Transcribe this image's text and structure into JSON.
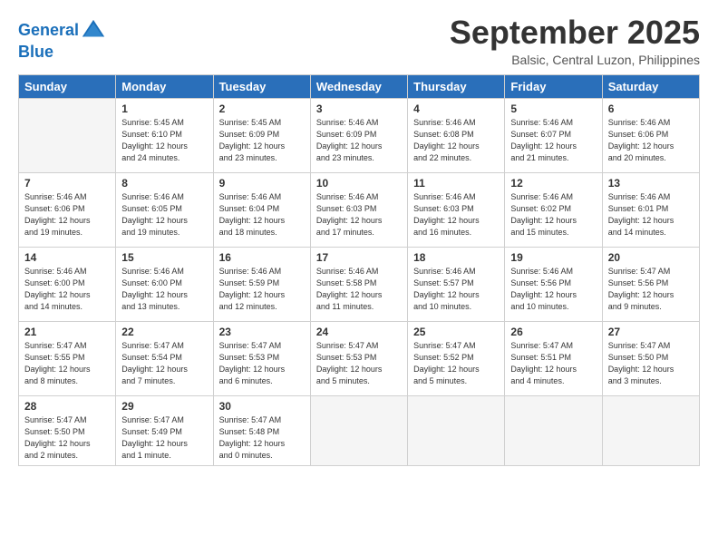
{
  "header": {
    "logo_line1": "General",
    "logo_line2": "Blue",
    "month_title": "September 2025",
    "location": "Balsic, Central Luzon, Philippines"
  },
  "days_of_week": [
    "Sunday",
    "Monday",
    "Tuesday",
    "Wednesday",
    "Thursday",
    "Friday",
    "Saturday"
  ],
  "weeks": [
    [
      {
        "day": "",
        "info": ""
      },
      {
        "day": "1",
        "info": "Sunrise: 5:45 AM\nSunset: 6:10 PM\nDaylight: 12 hours\nand 24 minutes."
      },
      {
        "day": "2",
        "info": "Sunrise: 5:45 AM\nSunset: 6:09 PM\nDaylight: 12 hours\nand 23 minutes."
      },
      {
        "day": "3",
        "info": "Sunrise: 5:46 AM\nSunset: 6:09 PM\nDaylight: 12 hours\nand 23 minutes."
      },
      {
        "day": "4",
        "info": "Sunrise: 5:46 AM\nSunset: 6:08 PM\nDaylight: 12 hours\nand 22 minutes."
      },
      {
        "day": "5",
        "info": "Sunrise: 5:46 AM\nSunset: 6:07 PM\nDaylight: 12 hours\nand 21 minutes."
      },
      {
        "day": "6",
        "info": "Sunrise: 5:46 AM\nSunset: 6:06 PM\nDaylight: 12 hours\nand 20 minutes."
      }
    ],
    [
      {
        "day": "7",
        "info": "Sunrise: 5:46 AM\nSunset: 6:06 PM\nDaylight: 12 hours\nand 19 minutes."
      },
      {
        "day": "8",
        "info": "Sunrise: 5:46 AM\nSunset: 6:05 PM\nDaylight: 12 hours\nand 19 minutes."
      },
      {
        "day": "9",
        "info": "Sunrise: 5:46 AM\nSunset: 6:04 PM\nDaylight: 12 hours\nand 18 minutes."
      },
      {
        "day": "10",
        "info": "Sunrise: 5:46 AM\nSunset: 6:03 PM\nDaylight: 12 hours\nand 17 minutes."
      },
      {
        "day": "11",
        "info": "Sunrise: 5:46 AM\nSunset: 6:03 PM\nDaylight: 12 hours\nand 16 minutes."
      },
      {
        "day": "12",
        "info": "Sunrise: 5:46 AM\nSunset: 6:02 PM\nDaylight: 12 hours\nand 15 minutes."
      },
      {
        "day": "13",
        "info": "Sunrise: 5:46 AM\nSunset: 6:01 PM\nDaylight: 12 hours\nand 14 minutes."
      }
    ],
    [
      {
        "day": "14",
        "info": "Sunrise: 5:46 AM\nSunset: 6:00 PM\nDaylight: 12 hours\nand 14 minutes."
      },
      {
        "day": "15",
        "info": "Sunrise: 5:46 AM\nSunset: 6:00 PM\nDaylight: 12 hours\nand 13 minutes."
      },
      {
        "day": "16",
        "info": "Sunrise: 5:46 AM\nSunset: 5:59 PM\nDaylight: 12 hours\nand 12 minutes."
      },
      {
        "day": "17",
        "info": "Sunrise: 5:46 AM\nSunset: 5:58 PM\nDaylight: 12 hours\nand 11 minutes."
      },
      {
        "day": "18",
        "info": "Sunrise: 5:46 AM\nSunset: 5:57 PM\nDaylight: 12 hours\nand 10 minutes."
      },
      {
        "day": "19",
        "info": "Sunrise: 5:46 AM\nSunset: 5:56 PM\nDaylight: 12 hours\nand 10 minutes."
      },
      {
        "day": "20",
        "info": "Sunrise: 5:47 AM\nSunset: 5:56 PM\nDaylight: 12 hours\nand 9 minutes."
      }
    ],
    [
      {
        "day": "21",
        "info": "Sunrise: 5:47 AM\nSunset: 5:55 PM\nDaylight: 12 hours\nand 8 minutes."
      },
      {
        "day": "22",
        "info": "Sunrise: 5:47 AM\nSunset: 5:54 PM\nDaylight: 12 hours\nand 7 minutes."
      },
      {
        "day": "23",
        "info": "Sunrise: 5:47 AM\nSunset: 5:53 PM\nDaylight: 12 hours\nand 6 minutes."
      },
      {
        "day": "24",
        "info": "Sunrise: 5:47 AM\nSunset: 5:53 PM\nDaylight: 12 hours\nand 5 minutes."
      },
      {
        "day": "25",
        "info": "Sunrise: 5:47 AM\nSunset: 5:52 PM\nDaylight: 12 hours\nand 5 minutes."
      },
      {
        "day": "26",
        "info": "Sunrise: 5:47 AM\nSunset: 5:51 PM\nDaylight: 12 hours\nand 4 minutes."
      },
      {
        "day": "27",
        "info": "Sunrise: 5:47 AM\nSunset: 5:50 PM\nDaylight: 12 hours\nand 3 minutes."
      }
    ],
    [
      {
        "day": "28",
        "info": "Sunrise: 5:47 AM\nSunset: 5:50 PM\nDaylight: 12 hours\nand 2 minutes."
      },
      {
        "day": "29",
        "info": "Sunrise: 5:47 AM\nSunset: 5:49 PM\nDaylight: 12 hours\nand 1 minute."
      },
      {
        "day": "30",
        "info": "Sunrise: 5:47 AM\nSunset: 5:48 PM\nDaylight: 12 hours\nand 0 minutes."
      },
      {
        "day": "",
        "info": ""
      },
      {
        "day": "",
        "info": ""
      },
      {
        "day": "",
        "info": ""
      },
      {
        "day": "",
        "info": ""
      }
    ]
  ]
}
